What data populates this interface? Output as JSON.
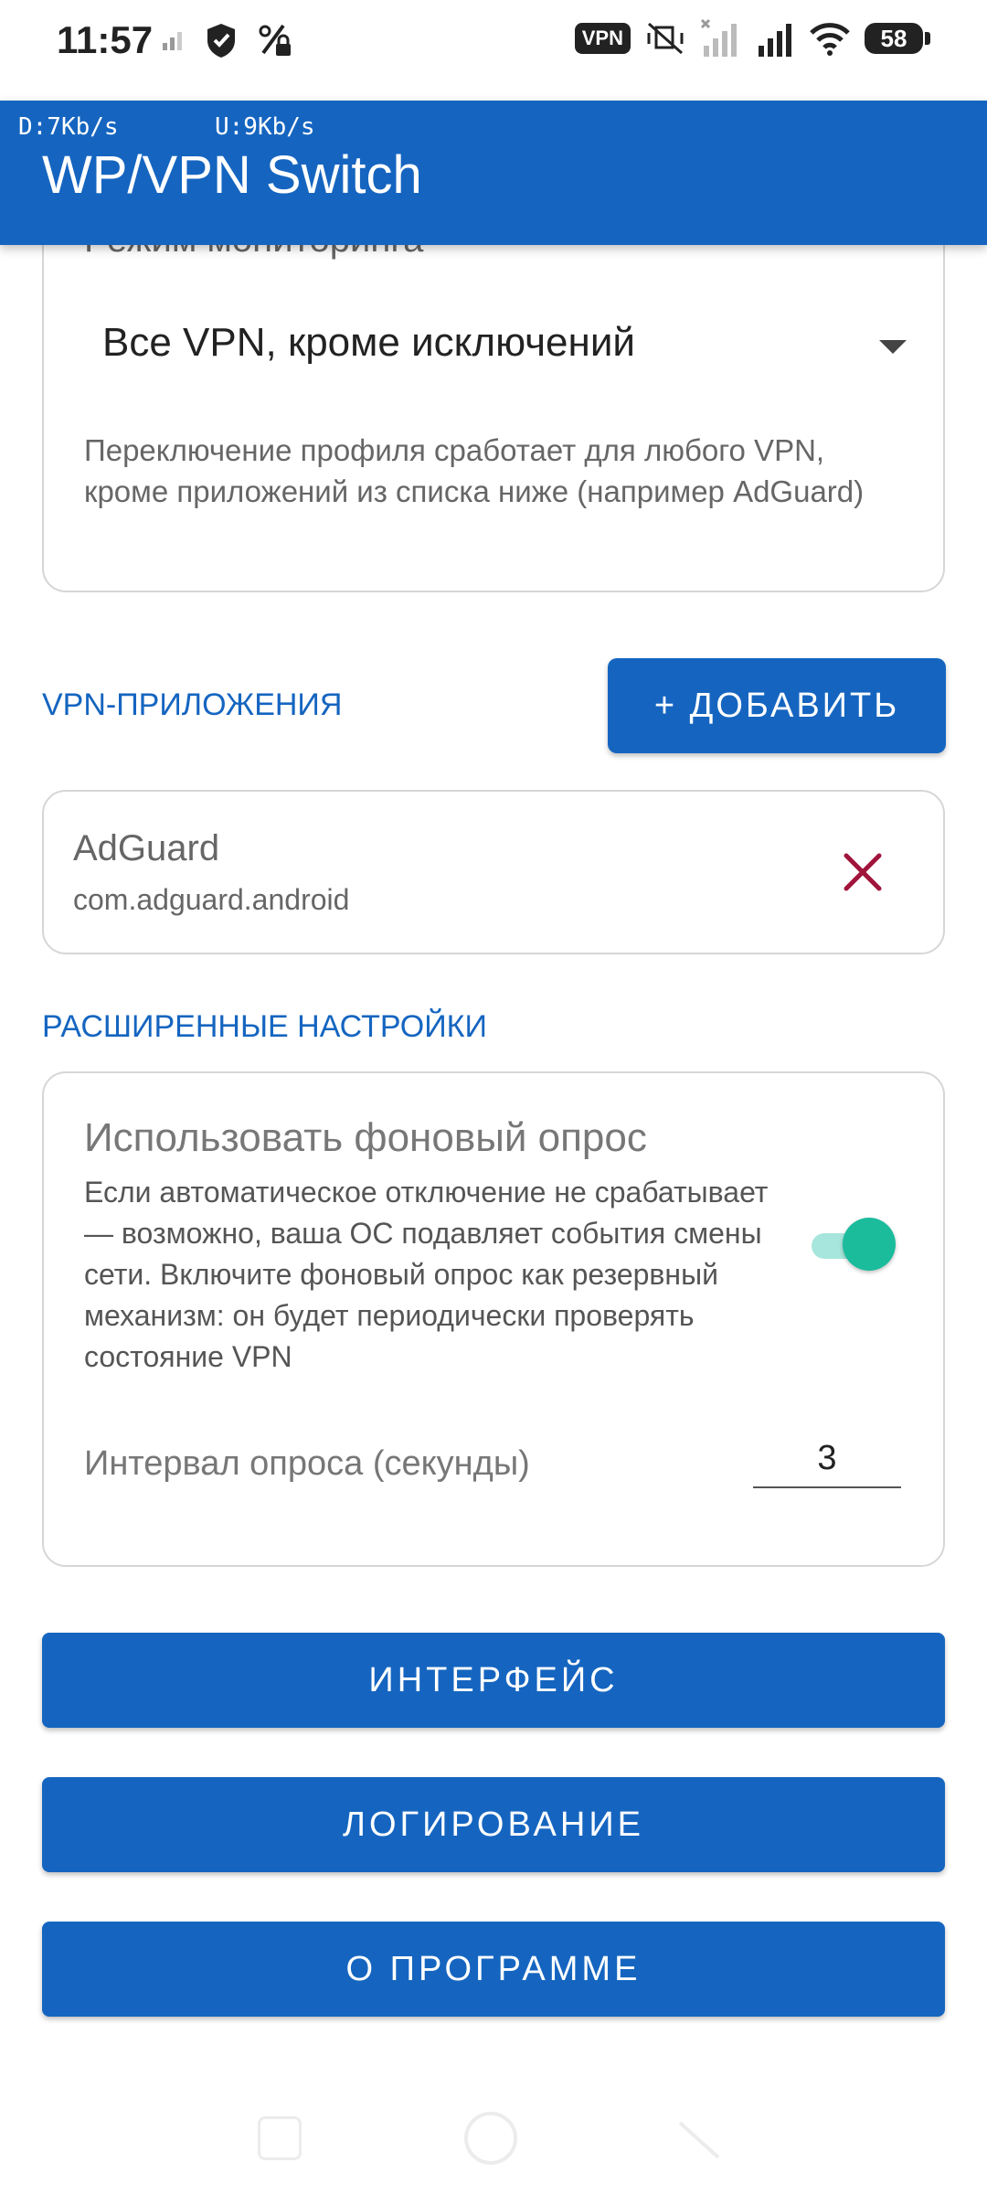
{
  "status_bar": {
    "time": "11:57",
    "vpn_badge": "VPN",
    "battery": "58"
  },
  "app_bar": {
    "download_speed": "D:7Kb/s",
    "upload_speed": "U:9Kb/s",
    "title": "WP/VPN Switch"
  },
  "monitoring": {
    "header": "Режим мониторинга",
    "selected": "Все VPN, кроме исключений",
    "description": "Переключение профиля сработает для любого VPN, кроме приложений из списка ниже (например AdGuard)"
  },
  "vpn_apps": {
    "section_label": "VPN-ПРИЛОЖЕНИЯ",
    "add_label": "+ ДОБАВИТЬ",
    "items": [
      {
        "name": "AdGuard",
        "package": "com.adguard.android"
      }
    ]
  },
  "advanced": {
    "section_label": "РАСШИРЕННЫЕ НАСТРОЙКИ",
    "polling_title": "Использовать фоновый опрос",
    "polling_desc": "Если автоматическое отключение не срабатывает — возможно, ваша ОС подавляет события смены сети. Включите фоновый опрос как резервный механизм: он будет периодически проверять состояние VPN",
    "polling_enabled": true,
    "interval_label": "Интервал опроса (секунды)",
    "interval_value": "3"
  },
  "buttons": {
    "interface": "ИНТЕРФЕЙС",
    "logging": "ЛОГИРОВАНИЕ",
    "about": "О ПРОГРАММЕ"
  },
  "colors": {
    "primary": "#1565C0",
    "toggle_on": "#1abc9c",
    "remove": "#a0143c"
  }
}
